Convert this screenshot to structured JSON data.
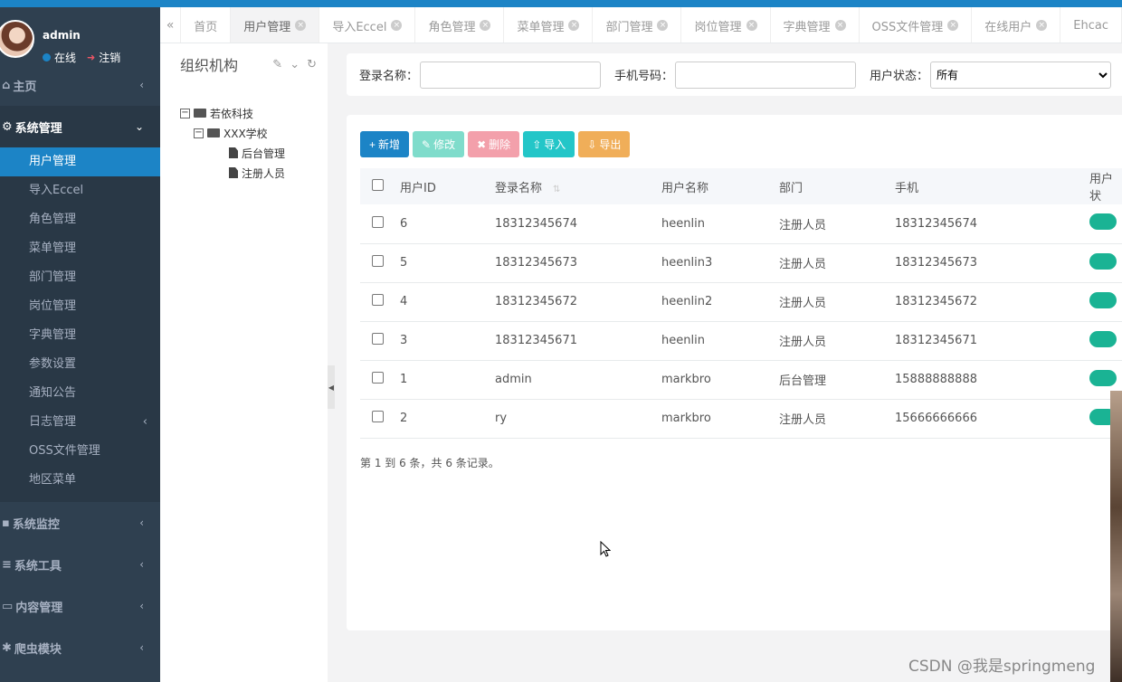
{
  "user": {
    "name": "admin",
    "online_label": "在线",
    "logout_label": "注销"
  },
  "sidebar": {
    "home": "主页",
    "system": "系统管理",
    "sub_items": [
      "用户管理",
      "导入Eccel",
      "角色管理",
      "菜单管理",
      "部门管理",
      "岗位管理",
      "字典管理",
      "参数设置",
      "通知公告",
      "日志管理",
      "OSS文件管理",
      "地区菜单"
    ],
    "bottom_items": [
      "系统监控",
      "系统工具",
      "内容管理",
      "爬虫模块"
    ]
  },
  "tabs": [
    "首页",
    "用户管理",
    "导入Eccel",
    "角色管理",
    "菜单管理",
    "部门管理",
    "岗位管理",
    "字典管理",
    "OSS文件管理",
    "在线用户",
    "Ehcac"
  ],
  "org": {
    "title": "组织机构",
    "tree": {
      "root": "若依科技",
      "school": "XXX学校",
      "children": [
        "后台管理",
        "注册人员"
      ]
    }
  },
  "search": {
    "login_label": "登录名称：",
    "phone_label": "手机号码：",
    "status_label": "用户状态：",
    "status_value": "所有"
  },
  "toolbar": {
    "add": "新增",
    "edit": "修改",
    "delete": "删除",
    "import": "导入",
    "export": "导出"
  },
  "table": {
    "headers": [
      "用户ID",
      "登录名称",
      "用户名称",
      "部门",
      "手机",
      "用户状"
    ],
    "rows": [
      [
        "6",
        "18312345674",
        "heenlin",
        "注册人员",
        "18312345674"
      ],
      [
        "5",
        "18312345673",
        "heenlin3",
        "注册人员",
        "18312345673"
      ],
      [
        "4",
        "18312345672",
        "heenlin2",
        "注册人员",
        "18312345672"
      ],
      [
        "3",
        "18312345671",
        "heenlin",
        "注册人员",
        "18312345671"
      ],
      [
        "1",
        "admin",
        "markbro",
        "后台管理",
        "15888888888"
      ],
      [
        "2",
        "ry",
        "markbro",
        "注册人员",
        "15666666666"
      ]
    ]
  },
  "pager": "第 1 到 6 条，共 6 条记录。",
  "watermark": "CSDN @我是springmeng",
  "colors": {
    "primary": "#1c84c6",
    "sidebar": "#2f4050",
    "toggle_on": "#1ab394"
  }
}
